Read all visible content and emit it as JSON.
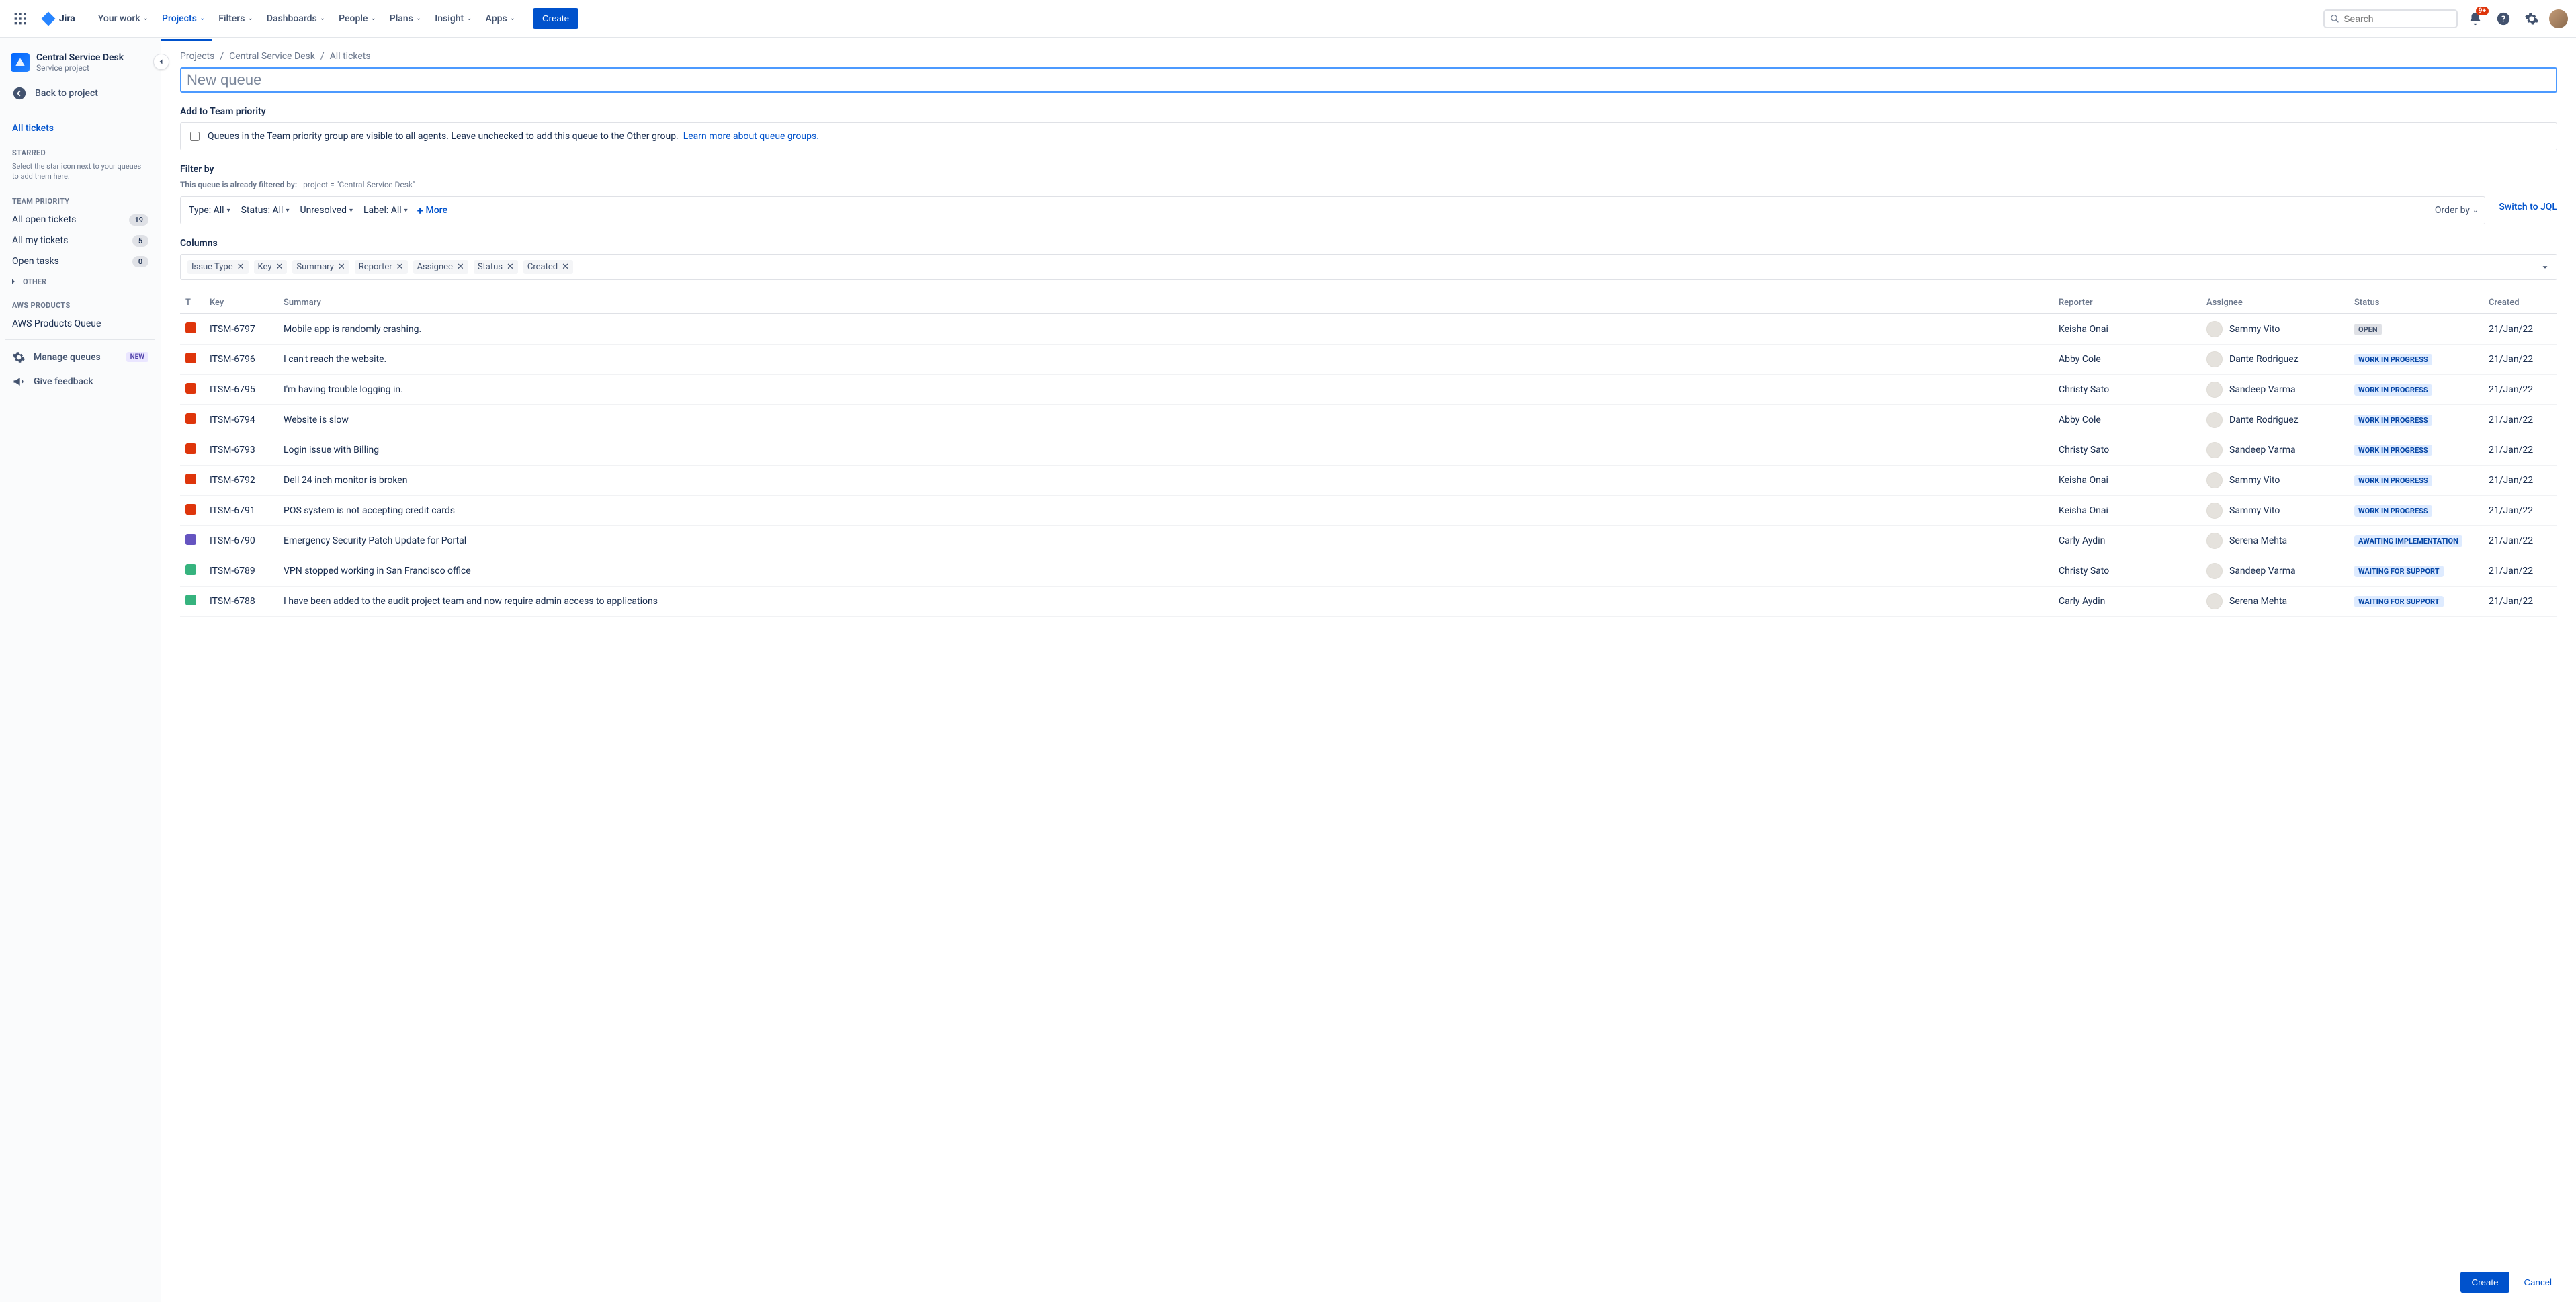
{
  "nav": {
    "logo": "Jira",
    "items": [
      "Your work",
      "Projects",
      "Filters",
      "Dashboards",
      "People",
      "Plans",
      "Insight",
      "Apps"
    ],
    "active_index": 1,
    "create": "Create",
    "search_placeholder": "Search",
    "notif_count": "9+"
  },
  "sidebar": {
    "project_name": "Central Service Desk",
    "project_type": "Service project",
    "back": "Back to project",
    "all_tickets": "All tickets",
    "starred_label": "STARRED",
    "starred_hint": "Select the star icon next to your queues to add them here.",
    "team_label": "TEAM PRIORITY",
    "team_items": [
      {
        "label": "All open tickets",
        "count": "19"
      },
      {
        "label": "All my tickets",
        "count": "5"
      },
      {
        "label": "Open tasks",
        "count": "0"
      }
    ],
    "other": "OTHER",
    "aws_label": "AWS PRODUCTS",
    "aws_item": "AWS Products Queue",
    "manage": "Manage queues",
    "new_badge": "NEW",
    "feedback": "Give feedback"
  },
  "breadcrumbs": [
    "Projects",
    "Central Service Desk",
    "All tickets"
  ],
  "name_placeholder": "New queue",
  "team_box": {
    "header": "Add to Team priority",
    "text": "Queues in the Team priority group are visible to all agents. Leave unchecked to add this queue to the Other group.",
    "link": "Learn more about queue groups."
  },
  "filters": {
    "header": "Filter by",
    "sub_prefix": "This queue is already filtered by:",
    "sub_default": "project = \"Central Service Desk\"",
    "pills": {
      "type": "Type: All",
      "status": "Status: All",
      "resolution": "Unresolved",
      "label": "Label: All"
    },
    "more": "More",
    "order_by": "Order by",
    "switch_jql": "Switch to JQL"
  },
  "columns": {
    "header": "Columns",
    "tags": [
      "Issue Type",
      "Key",
      "Summary",
      "Reporter",
      "Assignee",
      "Status",
      "Created"
    ]
  },
  "table_headers": {
    "t": "T",
    "key": "Key",
    "summary": "Summary",
    "reporter": "Reporter",
    "assignee": "Assignee",
    "status": "Status",
    "created": "Created"
  },
  "rows": [
    {
      "type": "red",
      "key": "ITSM-6797",
      "summary": "Mobile app is randomly crashing.",
      "reporter": "Keisha Onai",
      "assignee": "Sammy Vito",
      "status": "OPEN",
      "status_style": "default",
      "created": "21/Jan/22"
    },
    {
      "type": "red",
      "key": "ITSM-6796",
      "summary": "I can't reach the website.",
      "reporter": "Abby Cole",
      "assignee": "Dante Rodriguez",
      "status": "WORK IN PROGRESS",
      "status_style": "blue",
      "created": "21/Jan/22"
    },
    {
      "type": "red",
      "key": "ITSM-6795",
      "summary": "I'm having trouble logging in.",
      "reporter": "Christy Sato",
      "assignee": "Sandeep Varma",
      "status": "WORK IN PROGRESS",
      "status_style": "blue",
      "created": "21/Jan/22"
    },
    {
      "type": "red",
      "key": "ITSM-6794",
      "summary": "Website is slow",
      "reporter": "Abby Cole",
      "assignee": "Dante Rodriguez",
      "status": "WORK IN PROGRESS",
      "status_style": "blue",
      "created": "21/Jan/22"
    },
    {
      "type": "red",
      "key": "ITSM-6793",
      "summary": "Login issue with Billing",
      "reporter": "Christy Sato",
      "assignee": "Sandeep Varma",
      "status": "WORK IN PROGRESS",
      "status_style": "blue",
      "created": "21/Jan/22"
    },
    {
      "type": "red",
      "key": "ITSM-6792",
      "summary": "Dell 24 inch monitor is broken",
      "reporter": "Keisha Onai",
      "assignee": "Sammy Vito",
      "status": "WORK IN PROGRESS",
      "status_style": "blue",
      "created": "21/Jan/22"
    },
    {
      "type": "red",
      "key": "ITSM-6791",
      "summary": "POS system is not accepting credit cards",
      "reporter": "Keisha Onai",
      "assignee": "Sammy Vito",
      "status": "WORK IN PROGRESS",
      "status_style": "blue",
      "created": "21/Jan/22"
    },
    {
      "type": "purple",
      "key": "ITSM-6790",
      "summary": "Emergency Security Patch Update for Portal",
      "reporter": "Carly Aydin",
      "assignee": "Serena Mehta",
      "status": "AWAITING IMPLEMENTATION",
      "status_style": "blue",
      "created": "21/Jan/22"
    },
    {
      "type": "green",
      "key": "ITSM-6789",
      "summary": "VPN stopped working in San Francisco office",
      "reporter": "Christy Sato",
      "assignee": "Sandeep Varma",
      "status": "WAITING FOR SUPPORT",
      "status_style": "blue",
      "created": "21/Jan/22"
    },
    {
      "type": "green",
      "key": "ITSM-6788",
      "summary": "I have been added to the audit project team and now require admin access to applications",
      "reporter": "Carly Aydin",
      "assignee": "Serena Mehta",
      "status": "WAITING FOR SUPPORT",
      "status_style": "blue",
      "created": "21/Jan/22"
    }
  ],
  "footer": {
    "create": "Create",
    "cancel": "Cancel"
  }
}
